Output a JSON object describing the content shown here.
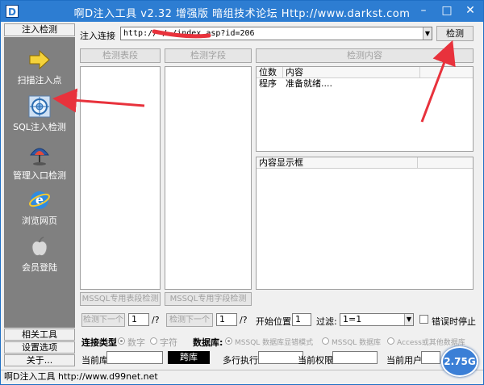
{
  "window": {
    "icon_letter": "D",
    "title": "啊D注入工具 v2.32 增强版 暗组技术论坛 Http://www.darkst.com",
    "minimize": "–",
    "maximize": "□",
    "close": "✕"
  },
  "sidebar": {
    "header": "注入检测",
    "items": [
      {
        "label": "扫描注入点",
        "icon": "arrow-right-icon"
      },
      {
        "label": "SQL注入检测",
        "icon": "crosshair-icon"
      },
      {
        "label": "管理入口检测",
        "icon": "umbrella-icon"
      },
      {
        "label": "浏览网页",
        "icon": "ie-browser-icon"
      },
      {
        "label": "会员登陆",
        "icon": "apple-icon"
      }
    ],
    "footer": [
      "相关工具",
      "设置选项",
      "关于..."
    ]
  },
  "main": {
    "url_label": "注入连接",
    "url_value": "http://        /    /index.asp?id=206",
    "detect_button": "检测",
    "tables_button": "检测表段",
    "fields_button": "检测字段",
    "content_button": "检测内容",
    "result_grid": {
      "headers": [
        "位数",
        "内容"
      ],
      "rows": [
        [
          "程序",
          "准备就绪...."
        ]
      ]
    },
    "content_box_header": "内容显示框",
    "mssql_tables_button": "MSSQL专用表段检测",
    "mssql_fields_button": "MSSQL专用字段检测",
    "next1_button": "检测下一个",
    "next1_value": "1",
    "next1_suffix": "/?",
    "next2_button": "检测下一个",
    "next2_value": "1",
    "next2_suffix": "/?",
    "start_pos_label": "开始位置",
    "start_pos_value": "1",
    "filter_label": "过滤:",
    "filter_value": "1=1",
    "stop_on_error_label": "错误时停止",
    "conn_type_label": "连接类型",
    "conn_type_options": [
      "数字",
      "字符"
    ],
    "db_label": "数据库:",
    "db_options": [
      "MSSQL 数据库显错模式",
      "MSSQL 数据库",
      "Access或其他数据库"
    ],
    "current_db_label": "当前库",
    "cross_db_button": "跨库",
    "multi_exec_label": "多行执行",
    "current_perm_label": "当前权限",
    "current_user_label": "当前用户"
  },
  "status": {
    "text": "啊D注入工具 http://www.d99net.net"
  },
  "badge": {
    "text": "2.75G"
  },
  "colors": {
    "titlebar": "#2d7dd2",
    "sidebar_panel": "#808080",
    "annotation_arrow": "#e8323c"
  }
}
